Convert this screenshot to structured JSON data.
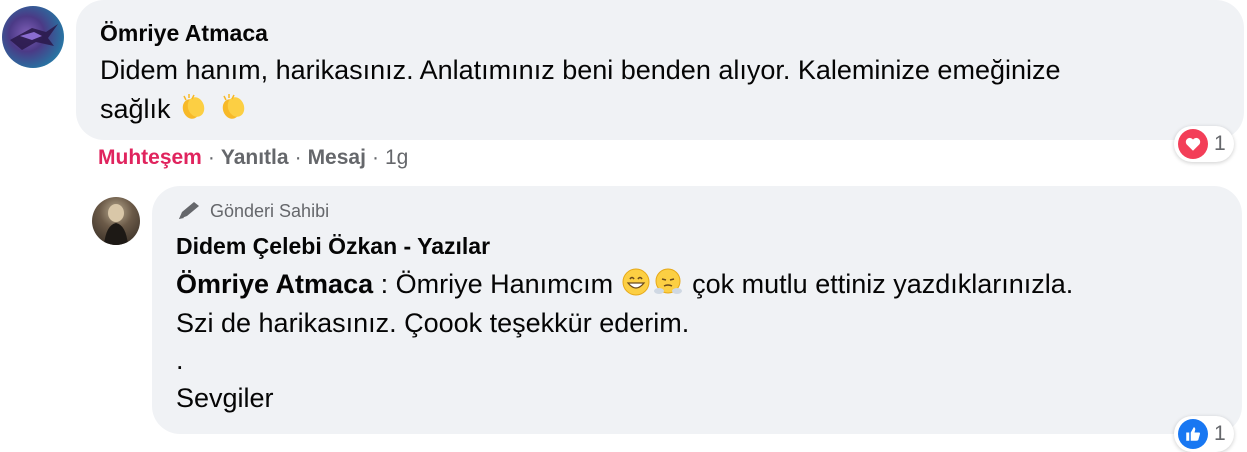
{
  "comment": {
    "author": "Ömriye Atmaca",
    "text_line1": "Didem hanım, harikasınız. Anlatımınız beni benden alıyor. Kaleminize emeğinize",
    "text_line2": "sağlık",
    "emojis": [
      "clapping-hands",
      "clapping-hands"
    ],
    "actions": {
      "reaction": "Muhteşem",
      "reply": "Yanıtla",
      "message": "Mesaj",
      "time": "1g"
    },
    "reaction_count": "1",
    "reaction_color": "#e0245e"
  },
  "reply": {
    "badge": "Gönderi Sahibi",
    "author": "Didem Çelebi Özkan - Yazılar",
    "mention": "Ömriye Atmaca",
    "text_line1": " : Ömriye Hanımcım",
    "text_line1_after": " çok mutlu ettiniz yazdıklarınızla.",
    "text_line2": "Szi de harikasınız. Çoook teşekkür ederim.",
    "text_line3": ".",
    "text_line4": "Sevgiler",
    "emojis": [
      "grinning-face",
      "face-with-steam"
    ],
    "reaction_count": "1",
    "reaction_color": "#1877f2"
  }
}
